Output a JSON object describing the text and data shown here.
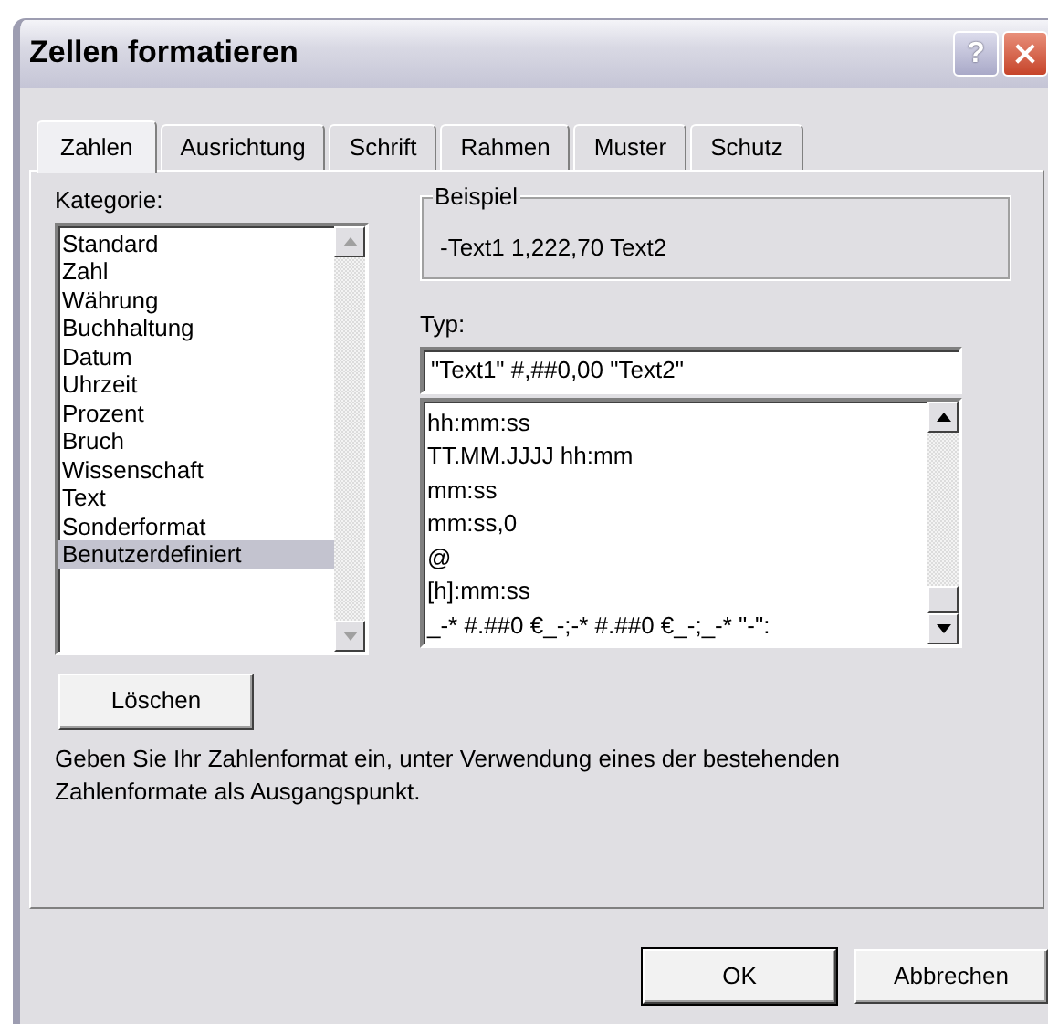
{
  "window": {
    "title": "Zellen formatieren",
    "help_button": "?"
  },
  "tabs": [
    {
      "label": "Zahlen",
      "selected": true
    },
    {
      "label": "Ausrichtung",
      "selected": false
    },
    {
      "label": "Schrift",
      "selected": false
    },
    {
      "label": "Rahmen",
      "selected": false
    },
    {
      "label": "Muster",
      "selected": false
    },
    {
      "label": "Schutz",
      "selected": false
    }
  ],
  "category": {
    "label": "Kategorie:",
    "items": [
      {
        "label": "Standard",
        "selected": false
      },
      {
        "label": "Zahl",
        "selected": false
      },
      {
        "label": "Währung",
        "selected": false
      },
      {
        "label": "Buchhaltung",
        "selected": false
      },
      {
        "label": "Datum",
        "selected": false
      },
      {
        "label": "Uhrzeit",
        "selected": false
      },
      {
        "label": "Prozent",
        "selected": false
      },
      {
        "label": "Bruch",
        "selected": false
      },
      {
        "label": "Wissenschaft",
        "selected": false
      },
      {
        "label": "Text",
        "selected": false
      },
      {
        "label": "Sonderformat",
        "selected": false
      },
      {
        "label": "Benutzerdefiniert",
        "selected": true
      }
    ]
  },
  "sample": {
    "label": "Beispiel",
    "value": "-Text1 1,222,70 Text2"
  },
  "type": {
    "label": "Typ:",
    "value": "\"Text1\" #,##0,00 \"Text2\"",
    "formats": [
      "hh:mm:ss",
      "TT.MM.JJJJ hh:mm",
      "mm:ss",
      "mm:ss,0",
      "@",
      "[h]:mm:ss",
      "_-* #.##0 €_-;-* #.##0 €_-;_-* \"-\":"
    ]
  },
  "delete_button": "Löschen",
  "description": "Geben Sie Ihr Zahlenformat ein, unter Verwendung eines der bestehenden Zahlenformate als Ausgangspunkt.",
  "buttons": [
    {
      "label": "OK",
      "default": true
    },
    {
      "label": "Abbrechen",
      "default": false
    }
  ]
}
